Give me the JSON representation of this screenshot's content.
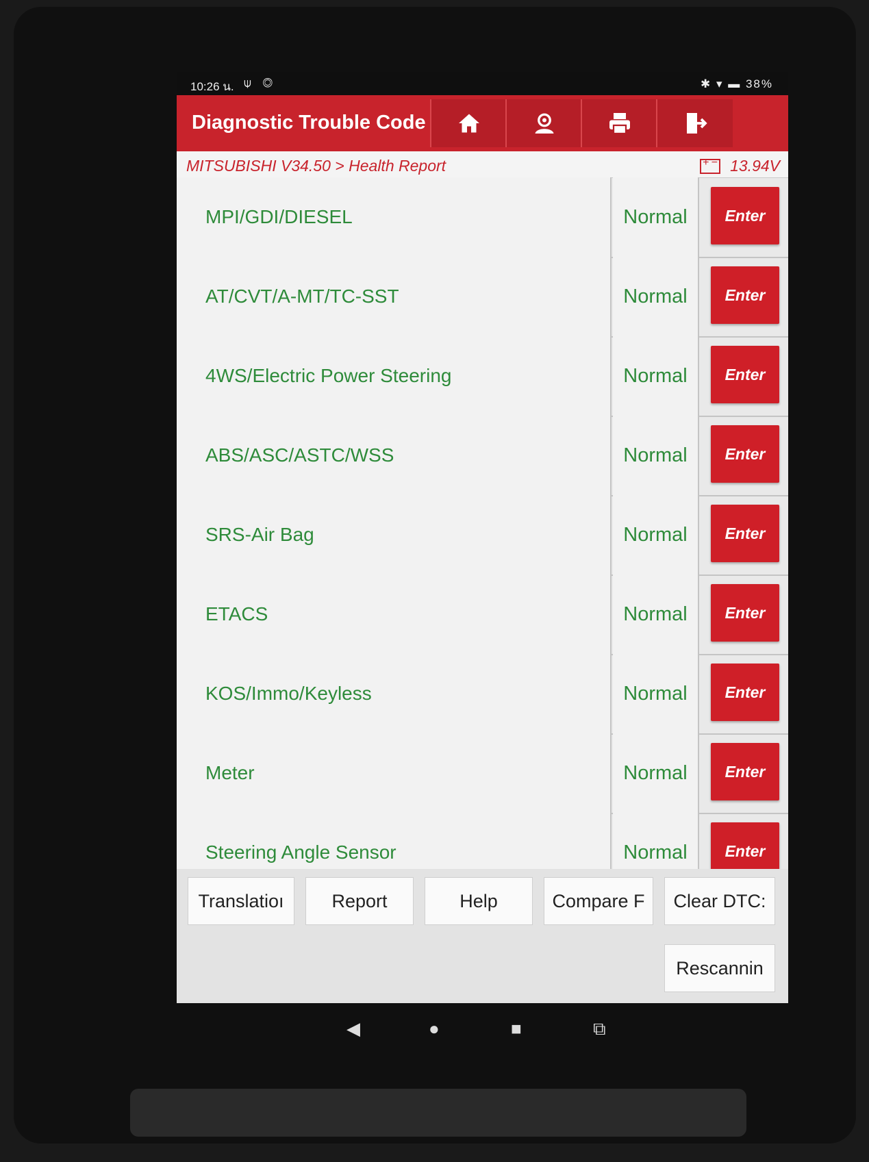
{
  "status_bar": {
    "time": "10:26 น.",
    "battery": "38%"
  },
  "header": {
    "title": "Diagnostic Trouble Code",
    "icons": [
      "home-icon",
      "user-icon",
      "print-icon",
      "exit-icon"
    ]
  },
  "breadcrumb": {
    "path": "MITSUBISHI V34.50 > Health Report",
    "voltage": "13.94V"
  },
  "systems": [
    {
      "name": "MPI/GDI/DIESEL",
      "status": "Normal",
      "action": "Enter"
    },
    {
      "name": "AT/CVT/A-MT/TC-SST",
      "status": "Normal",
      "action": "Enter"
    },
    {
      "name": "4WS/Electric Power Steering",
      "status": "Normal",
      "action": "Enter"
    },
    {
      "name": "ABS/ASC/ASTC/WSS",
      "status": "Normal",
      "action": "Enter"
    },
    {
      "name": "SRS-Air Bag",
      "status": "Normal",
      "action": "Enter"
    },
    {
      "name": "ETACS",
      "status": "Normal",
      "action": "Enter"
    },
    {
      "name": "KOS/Immo/Keyless",
      "status": "Normal",
      "action": "Enter"
    },
    {
      "name": "Meter",
      "status": "Normal",
      "action": "Enter"
    },
    {
      "name": "Steering Angle Sensor",
      "status": "Normal",
      "action": "Enter"
    }
  ],
  "actions": {
    "translation": "Translatioı",
    "report": "Report",
    "help": "Help",
    "compare": "Compare F",
    "clear_dtc": "Clear DTC:",
    "rescanning": "Rescannin"
  },
  "colors": {
    "brand_red": "#c8232c",
    "ok_green": "#2e8b3a"
  }
}
